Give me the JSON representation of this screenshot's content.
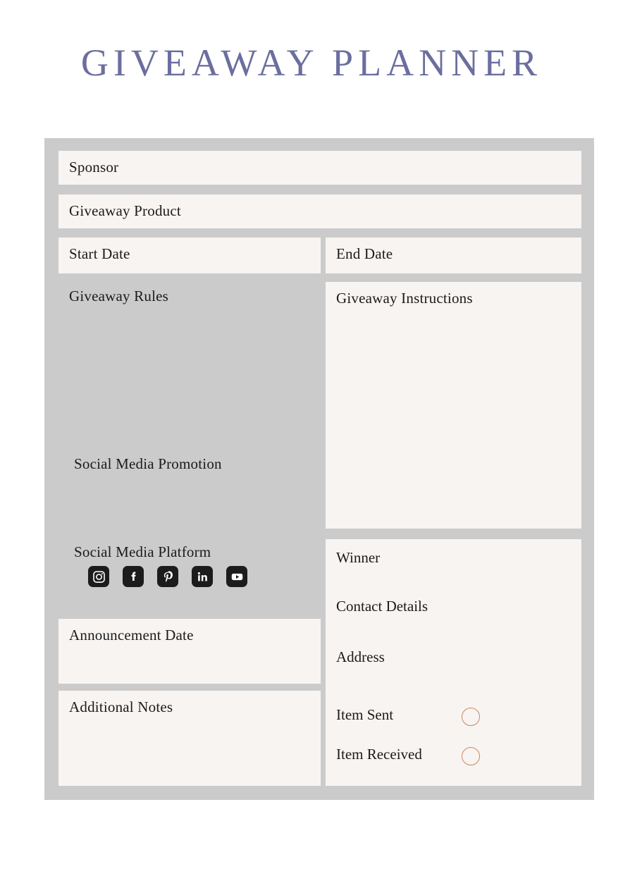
{
  "page": {
    "title": "GIVEAWAY PLANNER",
    "title_color": "#6b6e9e",
    "background_color": "#ffffff",
    "board_color": "#cbcbcb",
    "panel_color": "#f8f4f2",
    "text_color": "#1b1b1b",
    "accent_color": "#c98a5e"
  },
  "fields": {
    "sponsor": "Sponsor",
    "giveaway_product": "Giveaway Product",
    "start_date": "Start Date",
    "end_date": "End Date",
    "giveaway_rules": "Giveaway Rules",
    "giveaway_instructions": "Giveaway Instructions",
    "social_media_promotion": "Social Media Promotion",
    "social_media_platform": "Social Media Platform",
    "announcement_date": "Announcement Date",
    "additional_notes": "Additional Notes",
    "winner": "Winner",
    "contact_details": "Contact Details",
    "address": "Address",
    "item_sent": "Item Sent",
    "item_received": "Item Received"
  },
  "social_platforms": [
    {
      "name": "instagram",
      "icon": "instagram-icon"
    },
    {
      "name": "facebook",
      "icon": "facebook-icon"
    },
    {
      "name": "pinterest",
      "icon": "pinterest-icon"
    },
    {
      "name": "linkedin",
      "icon": "linkedin-icon"
    },
    {
      "name": "youtube",
      "icon": "youtube-icon"
    }
  ],
  "checkboxes": [
    {
      "label": "Item Sent",
      "checked": false
    },
    {
      "label": "Item Received",
      "checked": false
    }
  ]
}
